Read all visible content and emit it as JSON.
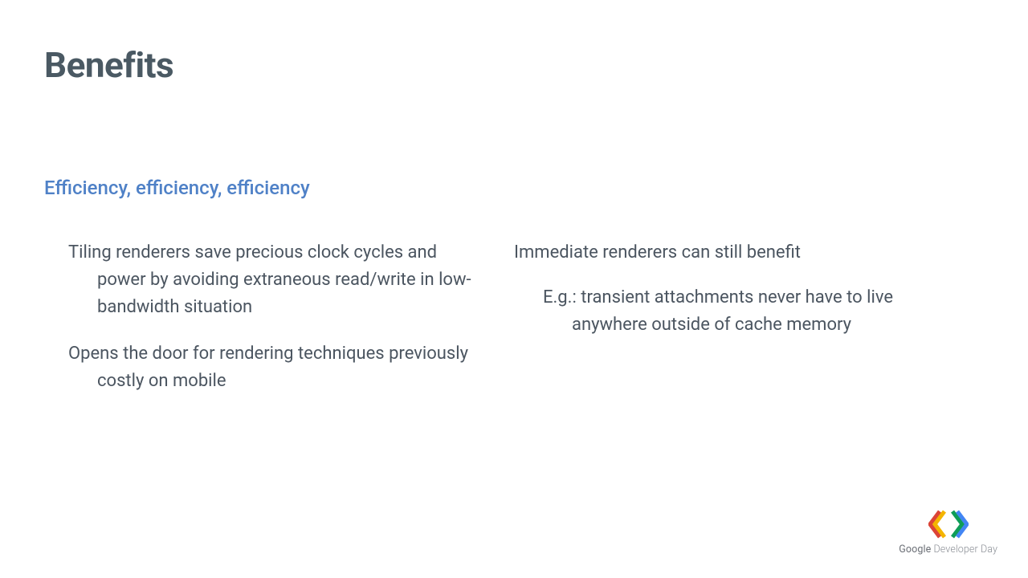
{
  "title": "Benefits",
  "subtitle": "Efficiency, efficiency, efficiency",
  "left": {
    "b1": "Tiling renderers save precious clock cycles and power by avoiding extraneous read/write in low-bandwidth situation",
    "b2": "Opens the door for rendering techniques previously costly on mobile"
  },
  "right": {
    "b1": "Immediate renderers can still benefit",
    "s1": "E.g.: transient attachments never have to live anywhere outside of cache memory"
  },
  "footer": {
    "brand": "Google",
    "rest": " Developer Day"
  },
  "colors": {
    "title": "#4a5963",
    "subtitle": "#4f81c7",
    "body": "#4b5560",
    "logo_red": "#db4437",
    "logo_yellow": "#f4b400",
    "logo_green": "#0f9d58",
    "logo_blue": "#4285f4"
  }
}
